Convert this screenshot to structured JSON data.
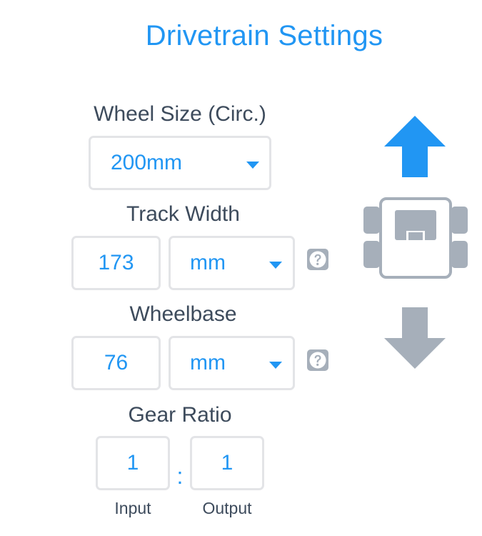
{
  "title": "Drivetrain Settings",
  "wheel_size": {
    "label": "Wheel Size (Circ.)",
    "selected": "200mm"
  },
  "track_width": {
    "label": "Track Width",
    "value": "173",
    "unit": "mm"
  },
  "wheelbase": {
    "label": "Wheelbase",
    "value": "76",
    "unit": "mm"
  },
  "gear_ratio": {
    "label": "Gear Ratio",
    "input_value": "1",
    "separator": ":",
    "output_value": "1",
    "input_label": "Input",
    "output_label": "Output"
  },
  "colors": {
    "accent": "#2196f3",
    "text": "#3d4b5c",
    "border": "#e3e4e7",
    "graphic_gray": "#a6afba"
  },
  "icons": {
    "forward": "arrow-up-icon",
    "robot": "robot-drivetrain-icon",
    "reverse": "arrow-down-icon",
    "help": "question-icon"
  }
}
